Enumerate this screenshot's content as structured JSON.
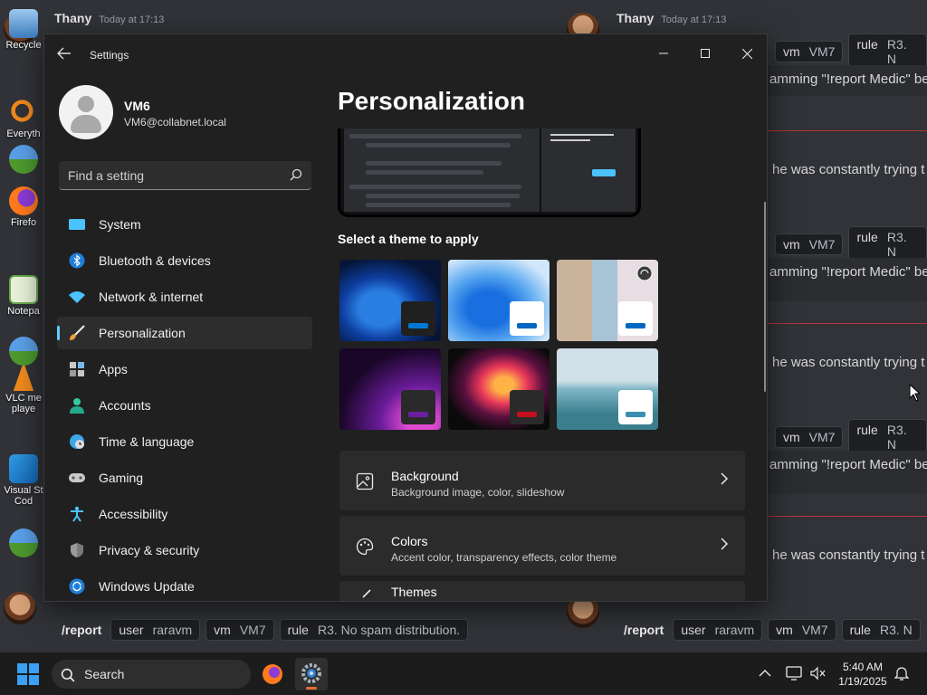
{
  "chat": {
    "author": "Thany",
    "timestamp": "Today at 17:13",
    "cmd_slash": "/report",
    "cmd_pills": [
      {
        "k": "user",
        "v": "raravm"
      },
      {
        "k": "vm",
        "v": "VM7"
      },
      {
        "k": "rule",
        "v": "R3. No spam distribution."
      }
    ],
    "right_pills": [
      {
        "k": "vm",
        "v": "VM7"
      },
      {
        "k": "rule",
        "v": "R3. N"
      }
    ],
    "line_spam": "amming \"!report Medic\" be",
    "line_trying": "he was constantly trying t"
  },
  "desktop_icons": [
    {
      "label": "Recycle"
    },
    {
      "label": "Everyth"
    },
    {
      "label": "Firefo"
    },
    {
      "label": "Notepa"
    },
    {
      "label": "VLC me\nplaye"
    },
    {
      "label": "Visual St\nCod"
    }
  ],
  "settings": {
    "window_title": "Settings",
    "profile": {
      "name": "VM6",
      "email": "VM6@collabnet.local"
    },
    "search_placeholder": "Find a setting",
    "nav": [
      {
        "label": "System",
        "icon": "monitor-icon",
        "active": false
      },
      {
        "label": "Bluetooth & devices",
        "icon": "bluetooth-icon",
        "active": false
      },
      {
        "label": "Network & internet",
        "icon": "wifi-icon",
        "active": false
      },
      {
        "label": "Personalization",
        "icon": "brush-icon",
        "active": true
      },
      {
        "label": "Apps",
        "icon": "apps-icon",
        "active": false
      },
      {
        "label": "Accounts",
        "icon": "person-icon",
        "active": false
      },
      {
        "label": "Time & language",
        "icon": "globe-clock-icon",
        "active": false
      },
      {
        "label": "Gaming",
        "icon": "gamepad-icon",
        "active": false
      },
      {
        "label": "Accessibility",
        "icon": "accessibility-icon",
        "active": false
      },
      {
        "label": "Privacy & security",
        "icon": "shield-icon",
        "active": false
      },
      {
        "label": "Windows Update",
        "icon": "update-icon",
        "active": false
      }
    ],
    "page_title": "Personalization",
    "theme_label": "Select a theme to apply",
    "themes": [
      {
        "name": "windows-dark",
        "accent": "#0078d4"
      },
      {
        "name": "windows-light",
        "accent": "#0067c0"
      },
      {
        "name": "captured-motion",
        "accent": "#0067c0"
      },
      {
        "name": "glow",
        "accent": "#6b1fa0"
      },
      {
        "name": "flow",
        "accent": "#c50f1f"
      },
      {
        "name": "sunrise",
        "accent": "#3a8fb0"
      }
    ],
    "cards": [
      {
        "title": "Background",
        "subtitle": "Background image, color, slideshow",
        "icon": "image-icon"
      },
      {
        "title": "Colors",
        "subtitle": "Accent color, transparency effects, color theme",
        "icon": "palette-icon"
      },
      {
        "title": "Themes",
        "subtitle": "",
        "icon": "brush-icon"
      }
    ]
  },
  "taskbar": {
    "search_label": "Search",
    "time": "5:40 AM",
    "date": "1/19/2025"
  }
}
